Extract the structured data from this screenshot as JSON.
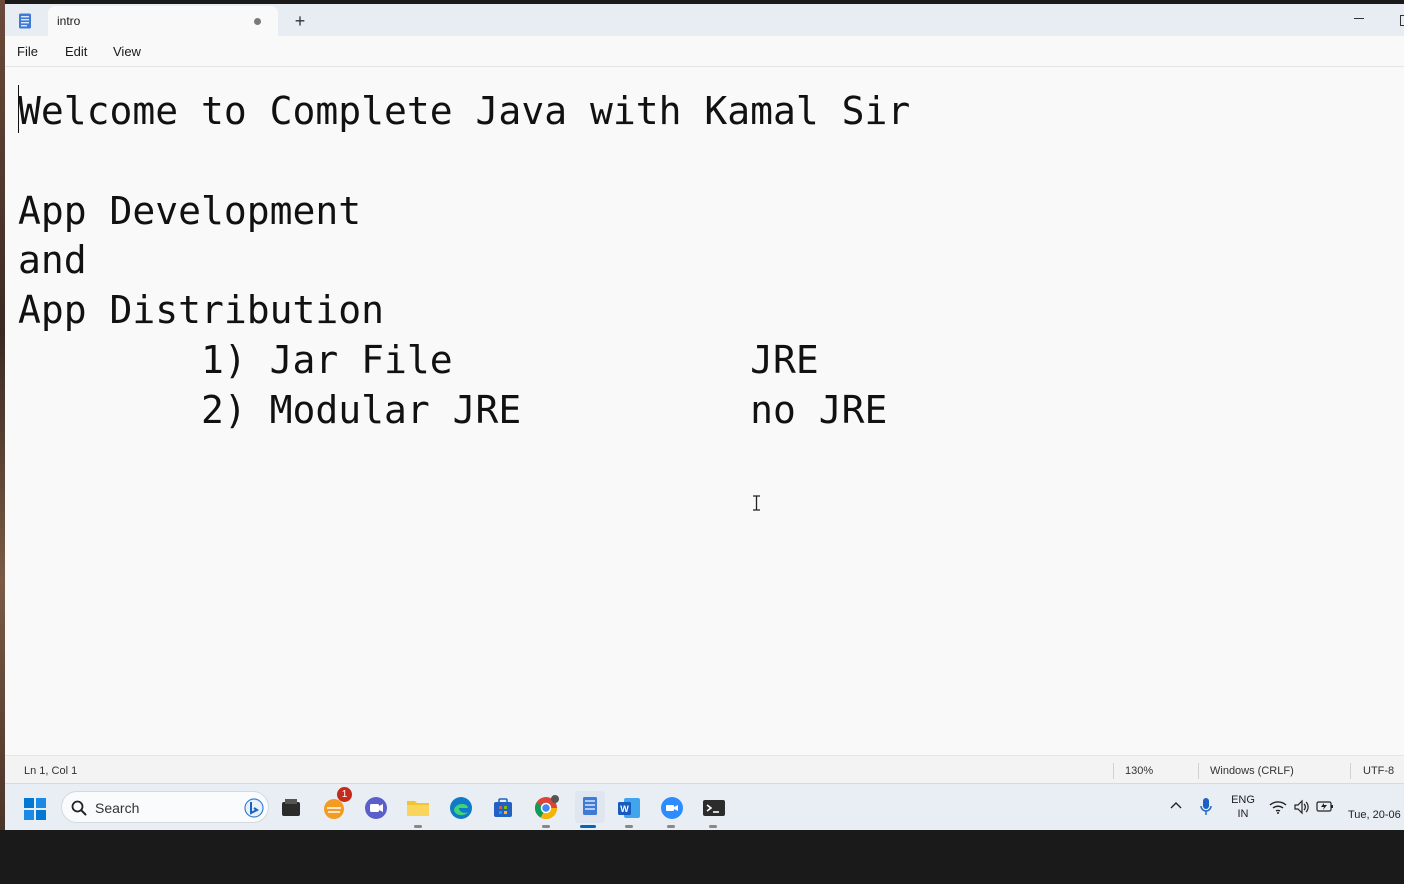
{
  "window": {
    "tab_title": "intro",
    "new_tab": "+"
  },
  "menu": {
    "file": "File",
    "edit": "Edit",
    "view": "View"
  },
  "editor": {
    "content": "Welcome to Complete Java with Kamal Sir\n\nApp Development\nand\nApp Distribution\n        1) Jar File             JRE\n        2) Modular JRE          no JRE"
  },
  "status": {
    "position": "Ln 1, Col 1",
    "zoom": "130%",
    "line_ending": "Windows (CRLF)",
    "encoding": "UTF-8"
  },
  "taskbar": {
    "search_placeholder": "Search",
    "notification_badge": "1",
    "language": "ENG",
    "region": "IN",
    "clock": "Tue, 20-06",
    "icons": [
      "windows-start-icon",
      "file-browser-icon",
      "chat-icon",
      "video-call-icon",
      "folder-icon",
      "edge-icon",
      "store-icon",
      "chrome-icon",
      "notepad-icon",
      "word-icon",
      "zoom-icon",
      "terminal-icon"
    ]
  },
  "colors": {
    "accent": "#0067c0",
    "window_bg": "#f9f9f9",
    "titlebar_bg": "#e8edf3",
    "taskbar_bg": "#e9eef5"
  }
}
